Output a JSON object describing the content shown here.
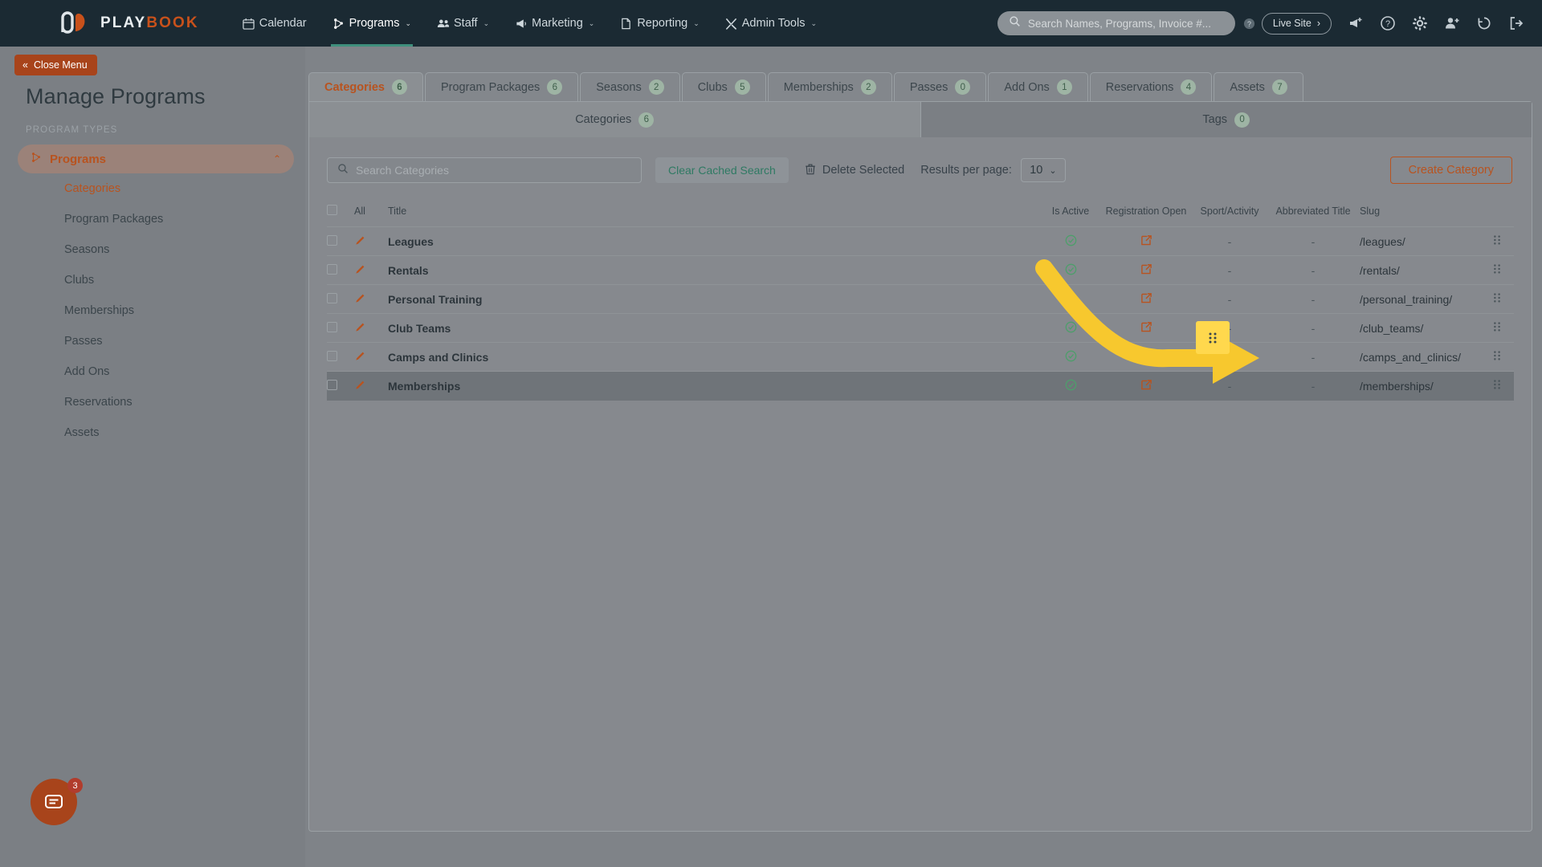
{
  "topnav": {
    "brand": {
      "text_play": "PLAY",
      "text_book": "BOOK",
      "logo_icon": "playbook-logo-icon"
    },
    "items": [
      {
        "label": "Calendar",
        "icon": "calendar-icon",
        "caret": "",
        "active": false
      },
      {
        "label": "Programs",
        "icon": "programs-icon",
        "caret": "⌄",
        "active": true
      },
      {
        "label": "Staff",
        "icon": "staff-icon",
        "caret": "⌄",
        "active": false
      },
      {
        "label": "Marketing",
        "icon": "megaphone-icon",
        "caret": "⌄",
        "active": false
      },
      {
        "label": "Reporting",
        "icon": "report-icon",
        "caret": "⌄",
        "active": false
      },
      {
        "label": "Admin Tools",
        "icon": "tools-icon",
        "caret": "⌄",
        "active": false
      }
    ],
    "search": {
      "placeholder": "Search Names, Programs, Invoice #...",
      "icon": "search-icon"
    },
    "help_badge_icon": "question-circle-icon",
    "live_site": {
      "label": "Live Site",
      "chevron": "›"
    },
    "right_icons": [
      {
        "name": "announcement-add-icon"
      },
      {
        "name": "help-circle-icon"
      },
      {
        "name": "gear-icon"
      },
      {
        "name": "add-user-icon"
      },
      {
        "name": "history-icon"
      },
      {
        "name": "logout-icon"
      }
    ]
  },
  "sidebar": {
    "close_menu": {
      "label": "Close Menu",
      "icon": "double-chevron-left-icon"
    },
    "page_title": "Manage Programs",
    "section_label": "PROGRAM TYPES",
    "group": {
      "label": "Programs",
      "icon": "programs-branch-icon",
      "chevron": "⌃"
    },
    "items": [
      {
        "label": "Categories",
        "active": true
      },
      {
        "label": "Program Packages",
        "active": false
      },
      {
        "label": "Seasons",
        "active": false
      },
      {
        "label": "Clubs",
        "active": false
      },
      {
        "label": "Memberships",
        "active": false
      },
      {
        "label": "Passes",
        "active": false
      },
      {
        "label": "Add Ons",
        "active": false
      },
      {
        "label": "Reservations",
        "active": false
      },
      {
        "label": "Assets",
        "active": false
      }
    ],
    "chat": {
      "icon": "chat-bubble-icon",
      "badge": "3"
    }
  },
  "main": {
    "tabs": [
      {
        "label": "Categories",
        "count": "6",
        "active": true
      },
      {
        "label": "Program Packages",
        "count": "6",
        "active": false
      },
      {
        "label": "Seasons",
        "count": "2",
        "active": false
      },
      {
        "label": "Clubs",
        "count": "5",
        "active": false
      },
      {
        "label": "Memberships",
        "count": "2",
        "active": false
      },
      {
        "label": "Passes",
        "count": "0",
        "active": false
      },
      {
        "label": "Add Ons",
        "count": "1",
        "active": false
      },
      {
        "label": "Reservations",
        "count": "4",
        "active": false
      },
      {
        "label": "Assets",
        "count": "7",
        "active": false
      }
    ],
    "subtabs": [
      {
        "label": "Categories",
        "count": "6",
        "active": true
      },
      {
        "label": "Tags",
        "count": "0",
        "active": false
      }
    ],
    "toolbar": {
      "search_placeholder": "Search Categories",
      "search_value": "",
      "search_icon": "search-icon",
      "clear_cached_search": "Clear Cached Search",
      "delete_selected": "Delete Selected",
      "delete_icon": "trash-icon",
      "results_per_page_label": "Results per page:",
      "results_per_page_value": "10",
      "results_per_page_chevron": "⌄",
      "create_button": "Create Category"
    },
    "table": {
      "headers": [
        "All",
        "Title",
        "Is Active",
        "Registration Open",
        "Sport/Activity",
        "Abbreviated Title",
        "Slug"
      ],
      "rows": [
        {
          "title": "Leagues",
          "is_active": "check-circle-icon",
          "registration_open": "external-link-icon",
          "sport": "-",
          "abbrev": "-",
          "slug": "/leagues/",
          "handle": "drag-handle-icon",
          "selected": false
        },
        {
          "title": "Rentals",
          "is_active": "check-circle-icon",
          "registration_open": "external-link-icon",
          "sport": "-",
          "abbrev": "-",
          "slug": "/rentals/",
          "handle": "drag-handle-icon",
          "selected": false
        },
        {
          "title": "Personal Training",
          "is_active": "check-circle-icon",
          "registration_open": "external-link-icon",
          "sport": "-",
          "abbrev": "-",
          "slug": "/personal_training/",
          "handle": "drag-handle-icon",
          "selected": false
        },
        {
          "title": "Club Teams",
          "is_active": "check-circle-icon",
          "registration_open": "external-link-icon",
          "sport": "-",
          "abbrev": "-",
          "slug": "/club_teams/",
          "handle": "drag-handle-icon",
          "selected": false
        },
        {
          "title": "Camps and Clinics",
          "is_active": "check-circle-icon",
          "registration_open": "external-link-icon",
          "sport": "-",
          "abbrev": "-",
          "slug": "/camps_and_clinics/",
          "handle": "drag-handle-icon",
          "selected": false
        },
        {
          "title": "Memberships",
          "is_active": "check-circle-icon",
          "registration_open": "external-link-icon",
          "sport": "-",
          "abbrev": "-",
          "slug": "/memberships/",
          "handle": "drag-handle-icon",
          "selected": true
        }
      ]
    }
  },
  "annotation": {
    "arrow_color": "#f7c82e",
    "highlight_color": "#ffd84d",
    "target": "drag-handle-icon of Memberships row"
  },
  "colors": {
    "brand_orange": "#b8531f",
    "nav_bg": "#1b2a33",
    "nav_active_underline": "#3e8f7c",
    "green_check": "#4e9e6b",
    "teal_text": "#2f7a63"
  }
}
